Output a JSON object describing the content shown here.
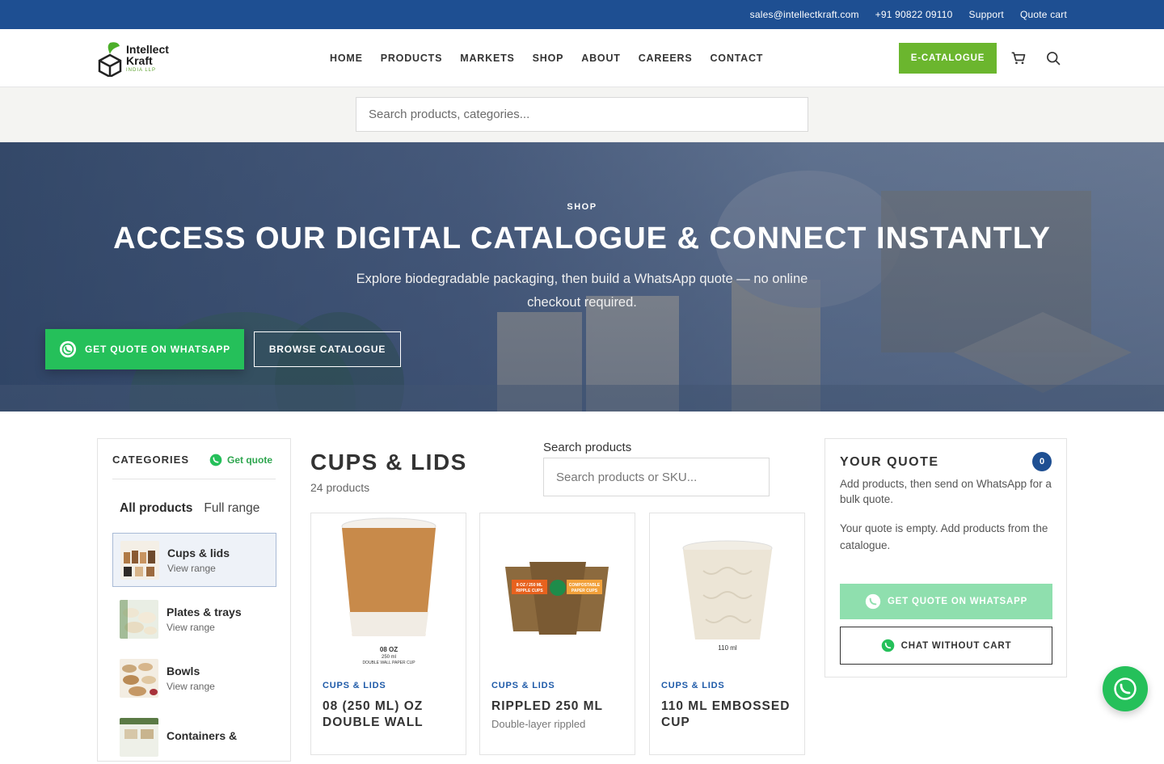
{
  "topbar": {
    "email": "sales@intellectkraft.com",
    "phone": "+91 90822 09110",
    "support": "Support",
    "quote_cart": "Quote cart"
  },
  "logo": {
    "line1": "Intellect",
    "line2": "Kraft",
    "line3": "INDIA LLP"
  },
  "nav": [
    "HOME",
    "PRODUCTS",
    "MARKETS",
    "SHOP",
    "ABOUT",
    "CAREERS",
    "CONTACT"
  ],
  "ecatalogue": "E-CATALOGUE",
  "search": {
    "placeholder": "Search products, categories..."
  },
  "hero": {
    "eyebrow": "SHOP",
    "title": "ACCESS OUR DIGITAL CATALOGUE & CONNECT INSTANTLY",
    "subtitle": "Explore biodegradable packaging, then build a WhatsApp quote — no online checkout required.",
    "btn_whatsapp": "GET QUOTE ON WHATSAPP",
    "btn_browse": "BROWSE CATALOGUE"
  },
  "sidebar": {
    "heading": "CATEGORIES",
    "get_quote": "Get quote",
    "all_label": "All products",
    "all_sub": "Full range",
    "categories": [
      {
        "name": "Cups & lids",
        "sub": "View range",
        "active": true
      },
      {
        "name": "Plates & trays",
        "sub": "View range",
        "active": false
      },
      {
        "name": "Bowls",
        "sub": "View range",
        "active": false
      },
      {
        "name": "Containers &",
        "sub": "",
        "active": false
      }
    ]
  },
  "main": {
    "title": "CUPS & LIDS",
    "count": "24 products",
    "search_label": "Search products",
    "search_placeholder": "Search products or SKU..."
  },
  "products": [
    {
      "category": "CUPS & LIDS",
      "name": "08 (250 ML) OZ DOUBLE WALL",
      "desc": "",
      "img_text": [
        "08 OZ",
        "250 ml",
        "DOUBLE WALL PAPER CUP"
      ]
    },
    {
      "category": "CUPS & LIDS",
      "name": "RIPPLED 250 ML",
      "desc": "Double-layer rippled",
      "img_text": [
        "8 OZ / 250 ML",
        "RIPPLE CUPS",
        "COMPOSTABLE",
        "PAPER CUPS"
      ]
    },
    {
      "category": "CUPS & LIDS",
      "name": "110 ML EMBOSSED CUP",
      "desc": "",
      "img_text": [
        "110 ml"
      ]
    }
  ],
  "quote": {
    "title": "YOUR QUOTE",
    "count": "0",
    "desc": "Add products, then send on WhatsApp for a bulk quote.",
    "empty": "Your quote is empty. Add products from the catalogue.",
    "btn_whatsapp": "GET QUOTE ON WHATSAPP",
    "btn_chat": "CHAT WITHOUT CART"
  },
  "colors": {
    "brand_blue": "#1e4f92",
    "brand_green": "#6bb62e",
    "whatsapp_green": "#25c05a"
  },
  "icons": [
    "cart-icon",
    "search-icon",
    "whatsapp-icon"
  ]
}
